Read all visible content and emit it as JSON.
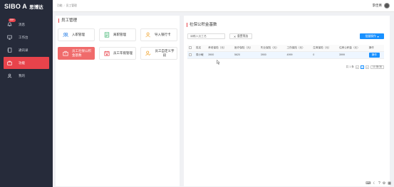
{
  "logo": {
    "mark": "SIBO A",
    "name": "思博达"
  },
  "sidebar": {
    "badge": "99+",
    "items": [
      {
        "label": "消息",
        "icon": "bell-icon"
      },
      {
        "label": "工作台",
        "icon": "desktop-icon"
      },
      {
        "label": "通讯录",
        "icon": "address-book-icon"
      },
      {
        "label": "功能",
        "icon": "briefcase-icon"
      },
      {
        "label": "我的",
        "icon": "user-icon"
      }
    ]
  },
  "topbar": {
    "crumb_home": "功能",
    "crumb_sep": "/",
    "crumb_current": "员工管理",
    "user_name": "李佳菁"
  },
  "left_panel": {
    "title": "员工管理",
    "cards": [
      {
        "label": "入职管理"
      },
      {
        "label": "离职管理"
      },
      {
        "label": "导入银行卡"
      },
      {
        "label": "员工社保公积金基数"
      },
      {
        "label": "员工年假管理"
      },
      {
        "label": "员工自定义字段"
      }
    ]
  },
  "right_panel": {
    "title": "社保公积金基数",
    "search_placeholder": "请输入员工名",
    "reset_label": "重置筛选",
    "batch_label": "批量操作",
    "columns": [
      "姓名",
      "养老保险（元）",
      "医疗保险（元）",
      "失业保险（元）",
      "工伤保险（元）",
      "生育保险（元）",
      "住房公积金（元）",
      "操作"
    ],
    "rows": [
      {
        "name": "周小敏",
        "pension": "3900",
        "medical": "5620",
        "unemployment": "3900",
        "injury": "4999",
        "maternity": "0",
        "housing": "3999",
        "action": "操作"
      }
    ],
    "pager": {
      "total": "共 1 条",
      "prev": "<",
      "page": "1",
      "next": ">",
      "size": "10 条/页"
    }
  },
  "colors": {
    "sidebar": "#262b3a",
    "accent": "#e8434b",
    "primary": "#1890ff"
  }
}
